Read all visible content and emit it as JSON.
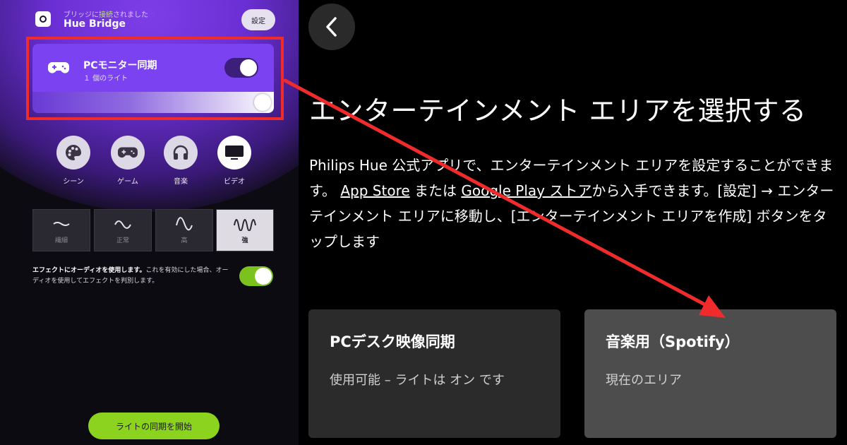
{
  "left_panel": {
    "bridge": {
      "status_prefix": "ブリッジに",
      "status_highlight": "接続",
      "status_suffix": "されました",
      "name": "Hue Bridge",
      "settings_label": "設定"
    },
    "sync_card": {
      "title": "PCモニター同期",
      "subtitle": "１ 個のライト",
      "toggle_on": true,
      "brightness_percent": 100
    },
    "modes": [
      {
        "label": "シーン",
        "icon": "palette-icon"
      },
      {
        "label": "ゲーム",
        "icon": "gamepad-icon"
      },
      {
        "label": "音楽",
        "icon": "headphones-icon"
      },
      {
        "label": "ビデオ",
        "icon": "tv-icon",
        "selected": true
      }
    ],
    "intensity": [
      {
        "label": "繊細"
      },
      {
        "label": "正常"
      },
      {
        "label": "高"
      },
      {
        "label": "強",
        "selected": true
      }
    ],
    "audio": {
      "bold_text": "エフェクトにオーディオを使用します。",
      "text": "これを有効にした場合、オーディオを使用してエフェクトを判別します。",
      "toggle_on": true
    },
    "start_button_label": "ライトの同期を開始"
  },
  "right_panel": {
    "heading": "エンターテインメント エリアを選択する",
    "description": {
      "part1": "Philips Hue 公式アプリで、エンターテインメント エリアを設定することができます。 ",
      "link1": "App Store",
      "part2": " または ",
      "link2": "Google Play ストア",
      "part3": "から入手できます。[設定] → エンターテインメント エリアに移動し、[エンターテインメント エリアを作成] ボタンをタップします"
    },
    "areas": [
      {
        "title": "PCデスク映像同期",
        "status": "使用可能 – ライトは オン です"
      },
      {
        "title": "音楽用（Spotify）",
        "status": "現在のエリア",
        "current": true
      }
    ]
  },
  "colors": {
    "accent_purple": "#7a42f0",
    "accent_green": "#8bd31f",
    "annotation_red": "#f02b2b"
  }
}
